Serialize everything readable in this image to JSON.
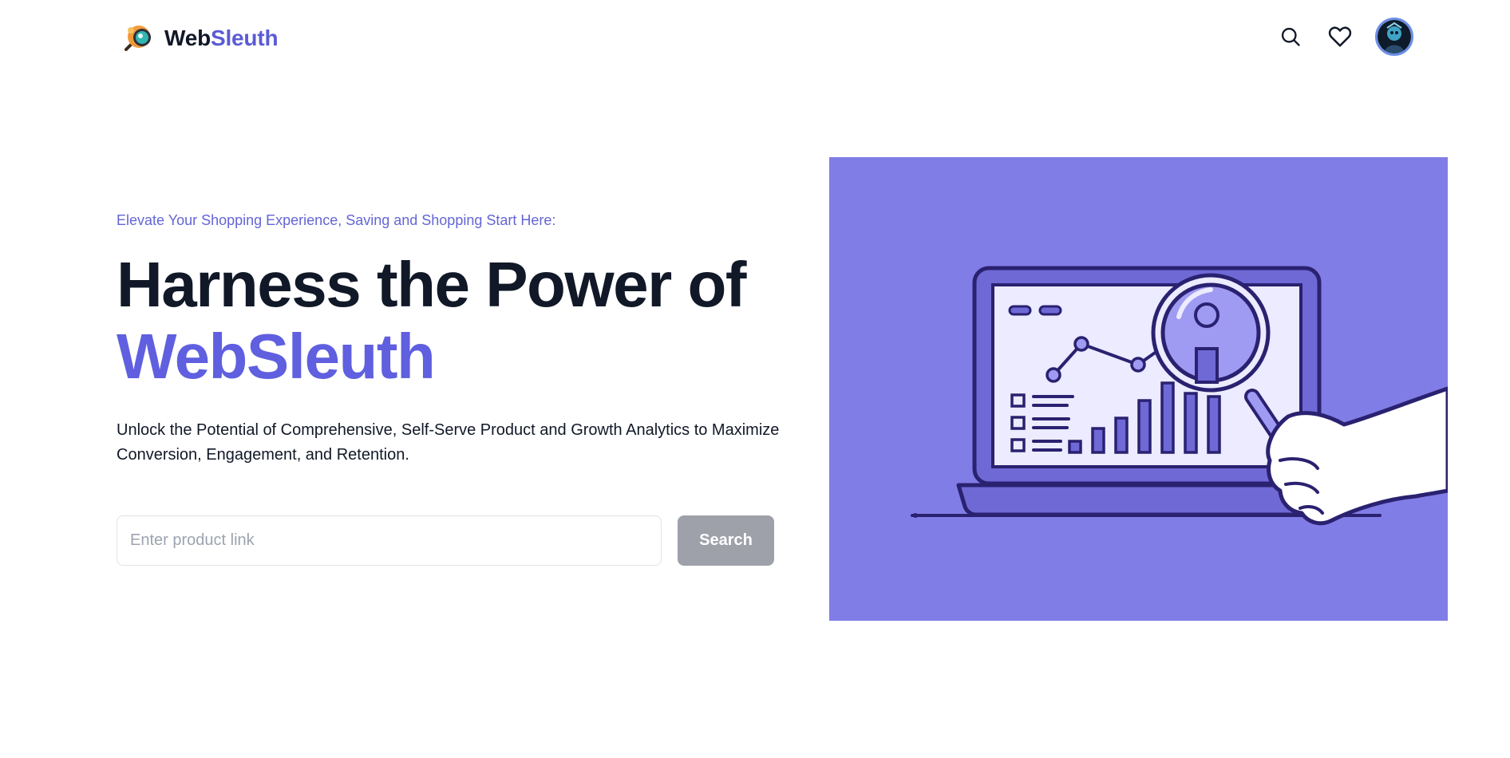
{
  "brand": {
    "name_part1": "Web",
    "name_part2": "Sleuth"
  },
  "nav": {
    "icons": [
      "search-icon",
      "heart-icon",
      "avatar"
    ]
  },
  "hero": {
    "tagline": "Elevate Your Shopping Experience, Saving and Shopping Start Here:",
    "headline_line1": "Harness the Power of",
    "headline_line2": "WebSleuth",
    "description": "Unlock the Potential of Comprehensive, Self-Serve Product and Growth Analytics to Maximize Conversion, Engagement, and Retention.",
    "search": {
      "placeholder": "Enter product link",
      "value": "",
      "button_label": "Search"
    },
    "illustration": "laptop-analytics-magnifier-illustration"
  },
  "colors": {
    "accent": "#5f5fe0",
    "tagline": "#6366d4",
    "illustration_bg": "#817de6",
    "button_disabled": "#9ea1aa",
    "text_dark": "#111827"
  }
}
